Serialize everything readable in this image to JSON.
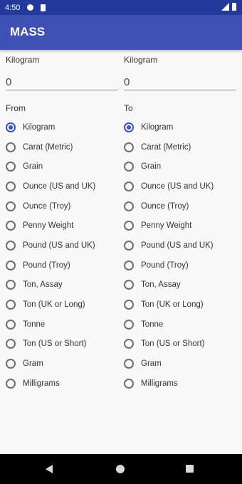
{
  "status_bar": {
    "time": "4:50",
    "icons": [
      "notification-dot-icon",
      "sd-card-icon",
      "signal-icon",
      "battery-icon"
    ]
  },
  "app_bar": {
    "title": "MASS",
    "color": "#3f51b5"
  },
  "left": {
    "unit_label": "Kilogram",
    "value": "0",
    "section_label": "From",
    "selected": "Kilogram"
  },
  "right": {
    "unit_label": "Kilogram",
    "value": "0",
    "section_label": "To",
    "selected": "Kilogram"
  },
  "units": [
    "Kilogram",
    "Carat (Metric)",
    "Grain",
    "Ounce (US and UK)",
    "Ounce (Troy)",
    "Penny Weight",
    "Pound (US and UK)",
    "Pound (Troy)",
    "Ton, Assay",
    "Ton (UK or Long)",
    "Tonne",
    "Ton (US or Short)",
    "Gram",
    "Milligrams"
  ],
  "nav_bar": {
    "icons": [
      "back-icon",
      "home-icon",
      "recents-icon"
    ]
  }
}
